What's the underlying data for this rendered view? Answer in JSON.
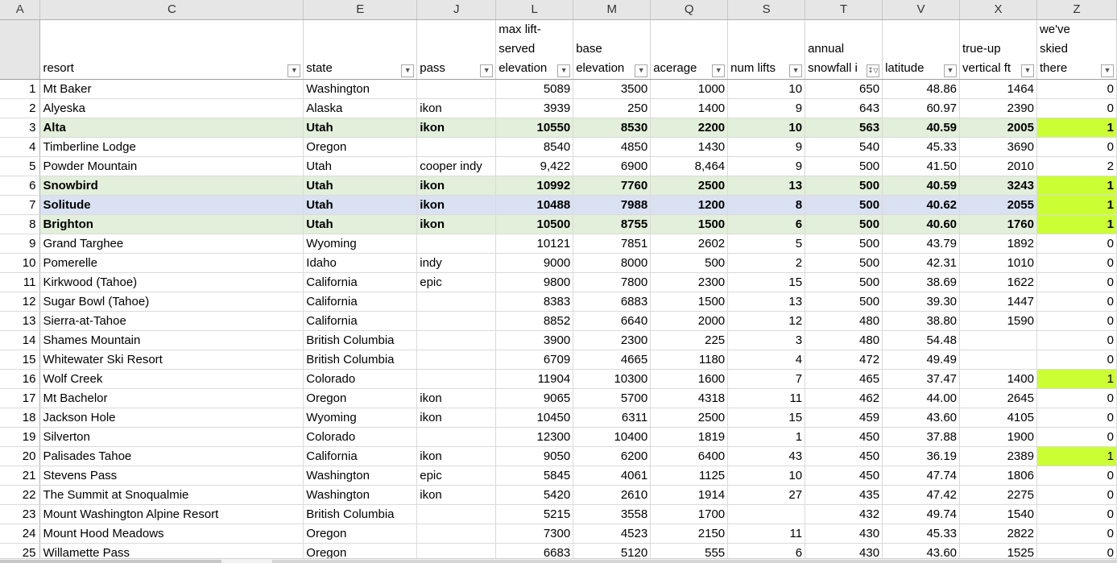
{
  "column_letters": [
    "A",
    "C",
    "E",
    "J",
    "L",
    "M",
    "Q",
    "S",
    "T",
    "V",
    "X",
    "Z"
  ],
  "headers": [
    {
      "key": "resort",
      "label": "resort",
      "filter_active": false
    },
    {
      "key": "state",
      "label": "state",
      "filter_active": false
    },
    {
      "key": "pass",
      "label": "pass",
      "filter_active": false
    },
    {
      "key": "max_elev",
      "label": "max lift-\nserved\nelevation",
      "filter_active": false
    },
    {
      "key": "base_elev",
      "label": "base\nelevation",
      "filter_active": false
    },
    {
      "key": "acerage",
      "label": "acerage",
      "filter_active": false
    },
    {
      "key": "num_lifts",
      "label": "num lifts",
      "filter_active": false
    },
    {
      "key": "snowfall",
      "label": "annual\nsnowfall i",
      "filter_active": true
    },
    {
      "key": "latitude",
      "label": "latitude",
      "filter_active": false
    },
    {
      "key": "vertical",
      "label": "true-up\nvertical ft",
      "filter_active": false
    },
    {
      "key": "skied",
      "label": "we've skied\nthere",
      "filter_active": false
    }
  ],
  "filter_icon": "dropdown-arrow-icon",
  "sort_filter_icon": "filter-sort-desc-icon",
  "highlight_colors": {
    "green": "#e2efda",
    "blue": "#d9e1f2",
    "lime": "#ccff33"
  },
  "rows": [
    {
      "n": "1",
      "cells": [
        "Mt Baker",
        "Washington",
        "",
        "5089",
        "3500",
        "1000",
        "10",
        "650",
        "48.86",
        "1464",
        "0"
      ],
      "style": "",
      "lime": false
    },
    {
      "n": "2",
      "cells": [
        "Alyeska",
        "Alaska",
        "ikon",
        "3939",
        "250",
        "1400",
        "9",
        "643",
        "60.97",
        "2390",
        "0"
      ],
      "style": "",
      "lime": false
    },
    {
      "n": "3",
      "cells": [
        "Alta",
        "Utah",
        "ikon",
        "10550",
        "8530",
        "2200",
        "10",
        "563",
        "40.59",
        "2005",
        "1"
      ],
      "style": "green",
      "lime": true
    },
    {
      "n": "4",
      "cells": [
        "Timberline Lodge",
        "Oregon",
        "",
        "8540",
        "4850",
        "1430",
        "9",
        "540",
        "45.33",
        "3690",
        "0"
      ],
      "style": "",
      "lime": false
    },
    {
      "n": "5",
      "cells": [
        "Powder Mountain",
        "Utah",
        "cooper indy",
        "9,422",
        "6900",
        "8,464",
        "9",
        "500",
        "41.50",
        "2010",
        "2"
      ],
      "style": "",
      "lime": false
    },
    {
      "n": "6",
      "cells": [
        "Snowbird",
        "Utah",
        "ikon",
        "10992",
        "7760",
        "2500",
        "13",
        "500",
        "40.59",
        "3243",
        "1"
      ],
      "style": "green",
      "lime": true
    },
    {
      "n": "7",
      "cells": [
        "Solitude",
        "Utah",
        "ikon",
        "10488",
        "7988",
        "1200",
        "8",
        "500",
        "40.62",
        "2055",
        "1"
      ],
      "style": "blue",
      "lime": true
    },
    {
      "n": "8",
      "cells": [
        "Brighton",
        "Utah",
        "ikon",
        "10500",
        "8755",
        "1500",
        "6",
        "500",
        "40.60",
        "1760",
        "1"
      ],
      "style": "green",
      "lime": true
    },
    {
      "n": "9",
      "cells": [
        "Grand Targhee",
        "Wyoming",
        "",
        "10121",
        "7851",
        "2602",
        "5",
        "500",
        "43.79",
        "1892",
        "0"
      ],
      "style": "",
      "lime": false
    },
    {
      "n": "10",
      "cells": [
        "Pomerelle",
        "Idaho",
        "indy",
        "9000",
        "8000",
        "500",
        "2",
        "500",
        "42.31",
        "1010",
        "0"
      ],
      "style": "",
      "lime": false
    },
    {
      "n": "11",
      "cells": [
        "Kirkwood (Tahoe)",
        "California",
        "epic",
        "9800",
        "7800",
        "2300",
        "15",
        "500",
        "38.69",
        "1622",
        "0"
      ],
      "style": "",
      "lime": false
    },
    {
      "n": "12",
      "cells": [
        "Sugar Bowl (Tahoe)",
        "California",
        "",
        "8383",
        "6883",
        "1500",
        "13",
        "500",
        "39.30",
        "1447",
        "0"
      ],
      "style": "",
      "lime": false
    },
    {
      "n": "13",
      "cells": [
        "Sierra-at-Tahoe",
        "California",
        "",
        "8852",
        "6640",
        "2000",
        "12",
        "480",
        "38.80",
        "1590",
        "0"
      ],
      "style": "",
      "lime": false
    },
    {
      "n": "14",
      "cells": [
        "Shames Mountain",
        "British Columbia",
        "",
        "3900",
        "2300",
        "225",
        "3",
        "480",
        "54.48",
        "",
        "0"
      ],
      "style": "",
      "lime": false
    },
    {
      "n": "15",
      "cells": [
        "Whitewater Ski Resort",
        "British Columbia",
        "",
        "6709",
        "4665",
        "1180",
        "4",
        "472",
        "49.49",
        "",
        "0"
      ],
      "style": "",
      "lime": false
    },
    {
      "n": "16",
      "cells": [
        "Wolf Creek",
        "Colorado",
        "",
        "11904",
        "10300",
        "1600",
        "7",
        "465",
        "37.47",
        "1400",
        "1"
      ],
      "style": "",
      "lime": true
    },
    {
      "n": "17",
      "cells": [
        "Mt Bachelor",
        "Oregon",
        "ikon",
        "9065",
        "5700",
        "4318",
        "11",
        "462",
        "44.00",
        "2645",
        "0"
      ],
      "style": "",
      "lime": false
    },
    {
      "n": "18",
      "cells": [
        "Jackson Hole",
        "Wyoming",
        "ikon",
        "10450",
        "6311",
        "2500",
        "15",
        "459",
        "43.60",
        "4105",
        "0"
      ],
      "style": "",
      "lime": false
    },
    {
      "n": "19",
      "cells": [
        "Silverton",
        "Colorado",
        "",
        "12300",
        "10400",
        "1819",
        "1",
        "450",
        "37.88",
        "1900",
        "0"
      ],
      "style": "",
      "lime": false
    },
    {
      "n": "20",
      "cells": [
        "Palisades Tahoe",
        "California",
        "ikon",
        "9050",
        "6200",
        "6400",
        "43",
        "450",
        "36.19",
        "2389",
        "1"
      ],
      "style": "",
      "lime": true
    },
    {
      "n": "21",
      "cells": [
        "Stevens Pass",
        "Washington",
        "epic",
        "5845",
        "4061",
        "1125",
        "10",
        "450",
        "47.74",
        "1806",
        "0"
      ],
      "style": "",
      "lime": false
    },
    {
      "n": "22",
      "cells": [
        "The Summit at Snoqualmie",
        "Washington",
        "ikon",
        "5420",
        "2610",
        "1914",
        "27",
        "435",
        "47.42",
        "2275",
        "0"
      ],
      "style": "",
      "lime": false
    },
    {
      "n": "23",
      "cells": [
        "Mount Washington Alpine Resort",
        "British Columbia",
        "",
        "5215",
        "3558",
        "1700",
        "",
        "432",
        "49.74",
        "1540",
        "0"
      ],
      "style": "",
      "lime": false
    },
    {
      "n": "24",
      "cells": [
        "Mount Hood Meadows",
        "Oregon",
        "",
        "7300",
        "4523",
        "2150",
        "11",
        "430",
        "45.33",
        "2822",
        "0"
      ],
      "style": "",
      "lime": false
    },
    {
      "n": "25",
      "cells": [
        "Willamette Pass",
        "Oregon",
        "",
        "6683",
        "5120",
        "555",
        "6",
        "430",
        "43.60",
        "1525",
        "0"
      ],
      "style": "",
      "lime": false
    }
  ]
}
